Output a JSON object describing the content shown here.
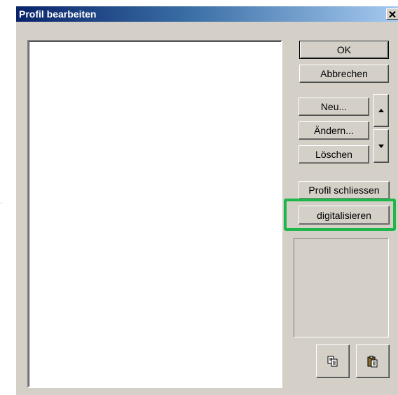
{
  "window": {
    "title": "Profil bearbeiten",
    "close_glyph": "✕"
  },
  "buttons": {
    "ok": "OK",
    "cancel": "Abbrechen",
    "new": "Neu...",
    "change": "Ändern...",
    "delete": "Löschen",
    "close_profile": "Profil schliessen",
    "digitize": "digitalisieren"
  },
  "icons": {
    "move_up": "arrow-up-icon",
    "move_down": "arrow-down-icon",
    "copy": "copy-icon",
    "paste": "paste-icon"
  },
  "colors": {
    "dialog_bg": "#d4d0c8",
    "title_gradient_start": "#0a246a",
    "title_gradient_end": "#a6caf0",
    "highlight": "#1eb54a"
  }
}
